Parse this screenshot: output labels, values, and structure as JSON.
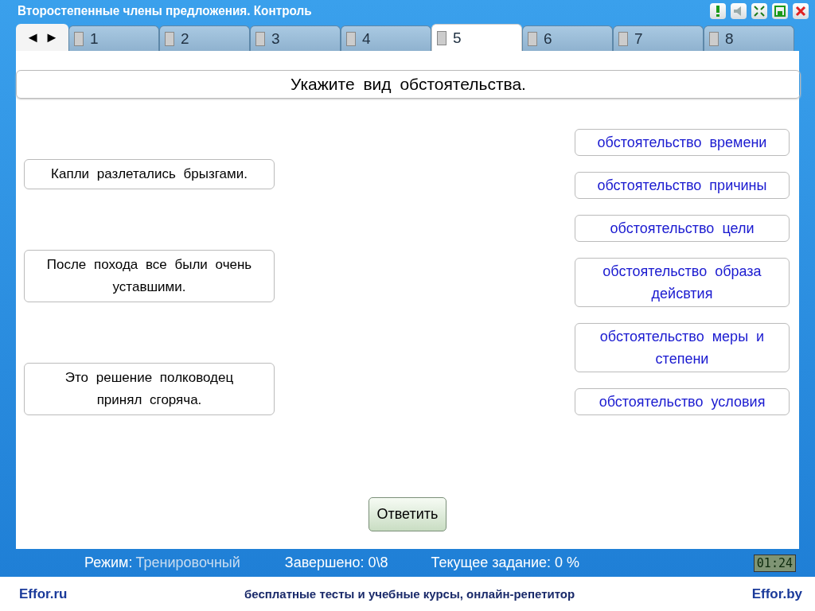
{
  "window": {
    "title": "Второстепенные члены предложения. Контроль"
  },
  "toolbar": [
    {
      "kind": "alert"
    },
    {
      "kind": "sound"
    },
    {
      "kind": "fullscreen"
    },
    {
      "kind": "save"
    },
    {
      "kind": "close"
    }
  ],
  "nav": {
    "prev": "◄",
    "next": "►"
  },
  "tabs": [
    {
      "label": "1",
      "selected": false
    },
    {
      "label": "2",
      "selected": false
    },
    {
      "label": "3",
      "selected": false
    },
    {
      "label": "4",
      "selected": false
    },
    {
      "label": "5",
      "selected": true
    },
    {
      "label": "6",
      "selected": false
    },
    {
      "label": "7",
      "selected": false
    },
    {
      "label": "8",
      "selected": false
    }
  ],
  "question": "Укажите вид обстоятельства.",
  "sentences": [
    "Капли разлетались брызгами.",
    "После похода все были очень уставшими.",
    "Это решение полководец принял сгоряча."
  ],
  "options": [
    "обстоятельство времени",
    "обстоятельство причины",
    "обстоятельство цели",
    "обстоятельство образа дейсвтия",
    "обстоятельство меры и степени",
    "обстоятельство условия"
  ],
  "answer_button": "Ответить",
  "status_bar": {
    "mode_label": "Режим:",
    "mode_value": "Тренировочный",
    "completed": "Завершено: 0\\8",
    "current": "Текущее задание: 0 %",
    "timer": "01:24"
  },
  "footer": {
    "left": "Effor.ru",
    "center": "бесплатные тесты и учебные курсы, онлайн-репетитор",
    "right": "Effor.by"
  }
}
